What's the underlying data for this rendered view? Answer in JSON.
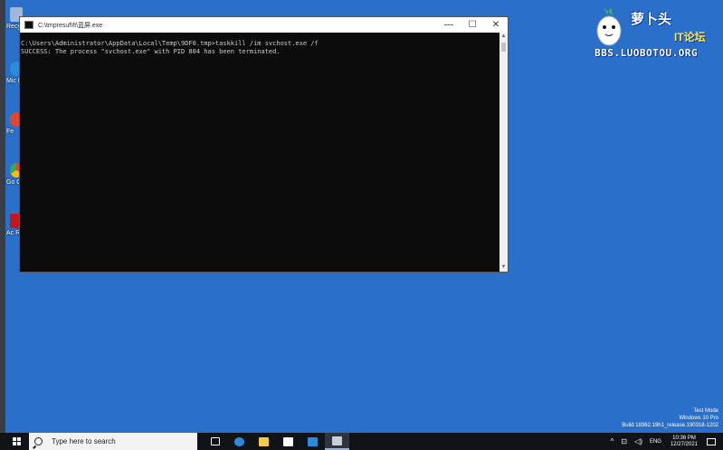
{
  "desktop": {
    "icons": [
      {
        "label": "Recy",
        "color": "#9fb7d8"
      },
      {
        "label": "Mic E",
        "color": "#2b8cde"
      },
      {
        "label": "Fe",
        "color": "#e3452f"
      },
      {
        "label": "Go Chr",
        "color": "#34a853"
      },
      {
        "label": "Ac Read",
        "color": "#c4161c"
      }
    ],
    "logo": {
      "cn_text": "萝卜头",
      "it_text": "IT论坛",
      "url_text": "BBS.LUOBOTOU.ORG"
    },
    "watermark": {
      "line1": "Test Mode",
      "line2": "Windows 10 Pro",
      "line3": "Build 18362.19h1_release.190318-1202"
    }
  },
  "cmd_window": {
    "title": "C:\\tmpresuf\\ft\\蓝屏.exe",
    "minimize": "—",
    "maximize": "☐",
    "close": "✕",
    "console_lines": [
      "C:\\Users\\Administrator\\AppData\\Local\\Temp\\9DF0.tmp>taskkill /im svchost.exe /f",
      "SUCCESS: The process \"svchost.exe\" with PID 804 has been terminated."
    ]
  },
  "taskbar": {
    "search_placeholder": "Type here to search",
    "pinned": [
      {
        "name": "task-view",
        "color": "#ffffff"
      },
      {
        "name": "edge",
        "color": "#2b8cde"
      },
      {
        "name": "file-explorer",
        "color": "#f2c94c"
      },
      {
        "name": "store",
        "color": "#ffffff"
      },
      {
        "name": "mail",
        "color": "#2b8cde"
      },
      {
        "name": "terminal",
        "color": "#c8d0d8"
      }
    ],
    "tray": {
      "chevron": "^",
      "language": "ENG",
      "time": "10:36 PM",
      "date": "12/27/2021"
    }
  }
}
